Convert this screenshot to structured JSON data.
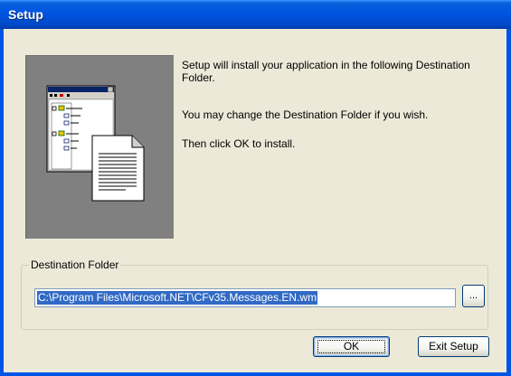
{
  "window": {
    "title": "Setup"
  },
  "message": {
    "line1": "Setup will install your application in the following Destination Folder.",
    "line2": "You may change the Destination Folder if you wish.",
    "line3": "Then click OK to install."
  },
  "destination": {
    "group_label": "Destination Folder",
    "path": "C:\\Program Files\\Microsoft.NET\\CFv35.Messages.EN.wm",
    "browse_label": "..."
  },
  "buttons": {
    "ok_label": "OK",
    "exit_label": "Exit Setup"
  },
  "icons": {
    "graphic": "setup-graphic-icon"
  },
  "colors": {
    "titlebar": "#0054e3",
    "dialog_bg": "#ece9d8",
    "graphic_panel": "#808080",
    "selection": "#316ac5"
  }
}
